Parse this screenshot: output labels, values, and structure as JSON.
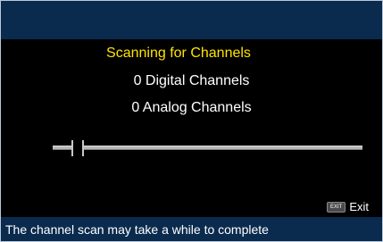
{
  "scan": {
    "title": "Scanning for Channels",
    "digital_count": "0 Digital Channels",
    "analog_count": "0 Analog Channels",
    "progress": 0.08
  },
  "exit": {
    "key_label": "EXIT",
    "label": "Exit"
  },
  "footer": {
    "message": "The channel scan may take a while to complete"
  },
  "colors": {
    "background": "#000000",
    "bar": "#0a2a4e",
    "title": "#ffe400",
    "text": "#ffffff"
  }
}
